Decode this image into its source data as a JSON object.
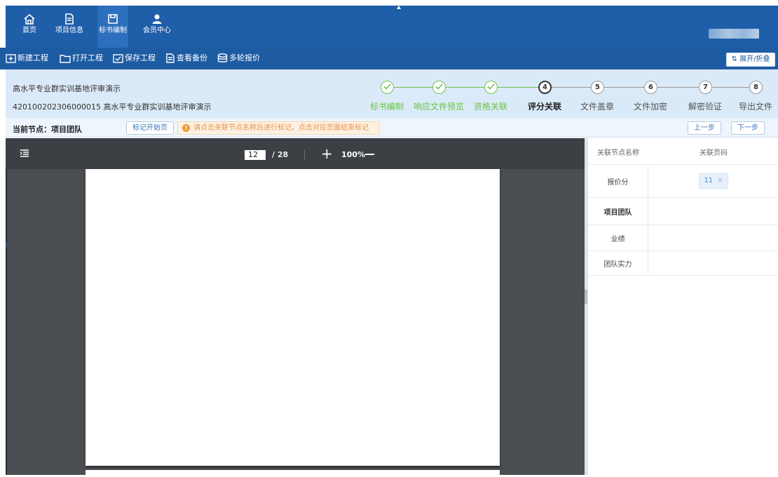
{
  "nav": {
    "items": [
      {
        "label": "首页",
        "icon": "home-icon"
      },
      {
        "label": "项目信息",
        "icon": "document-icon"
      },
      {
        "label": "标书编制",
        "icon": "save-icon"
      },
      {
        "label": "会员中心",
        "icon": "user-icon"
      }
    ],
    "active_index": 2
  },
  "toolbar": {
    "new_project": "新建工程",
    "open_project": "打开工程",
    "save_project": "保存工程",
    "view_backup": "查看备份",
    "multi_quote": "多轮报价",
    "expand_collapse": "展开/折叠"
  },
  "project": {
    "name": "高水平专业群实训基地评审演示",
    "code_name": "420100202306000015 高水平专业群实训基地评审演示"
  },
  "steps": [
    {
      "num": "1",
      "label": "标书编制",
      "state": "done"
    },
    {
      "num": "2",
      "label": "响应文件预览",
      "state": "done"
    },
    {
      "num": "3",
      "label": "资格关联",
      "state": "done"
    },
    {
      "num": "4",
      "label": "评分关联",
      "state": "current"
    },
    {
      "num": "5",
      "label": "文件盖章",
      "state": "todo"
    },
    {
      "num": "6",
      "label": "文件加密",
      "state": "todo"
    },
    {
      "num": "7",
      "label": "解密验证",
      "state": "todo"
    },
    {
      "num": "8",
      "label": "导出文件",
      "state": "todo"
    }
  ],
  "node_bar": {
    "current_node": "当前节点：项目团队",
    "mark_start": "标记开始页",
    "hint": "请点击关联节点名称后进行标记，点击对应页面结束标记",
    "prev": "上一步",
    "next": "下一步"
  },
  "viewer": {
    "current_page": "12",
    "total_pages": "/ 28",
    "zoom": "100%"
  },
  "table": {
    "headers": [
      "关联节点名称",
      "关联页码"
    ],
    "rows": [
      {
        "name": "报价分",
        "tag": "11"
      },
      {
        "name": "项目团队",
        "tag": ""
      },
      {
        "name": "业绩",
        "tag": ""
      },
      {
        "name": "团队实力",
        "tag": ""
      }
    ]
  },
  "colors": {
    "nav_bg": "#1f5ea8",
    "toolbar_bg": "#1d5ba3",
    "step_done": "#6cc24a",
    "hint_text": "#e8924a",
    "viewer_bg": "#4a4d51"
  }
}
